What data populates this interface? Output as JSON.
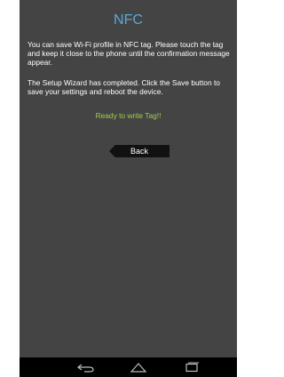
{
  "header": {
    "title": "NFC"
  },
  "content": {
    "instruction": "You can save Wi-Fi profile in NFC tag. Please touch the tag and keep it close to the phone until the confirmation message appear.",
    "completion": "The Setup Wizard has completed. Click the Save button to save your settings and reboot the device.",
    "status": "Ready to write Tag!!"
  },
  "actions": {
    "back_label": "Back"
  },
  "navbar": {
    "icons": [
      "back-icon",
      "home-icon",
      "recent-apps-icon"
    ]
  },
  "colors": {
    "background": "#444444",
    "title": "#5aa8dc",
    "status": "#9fd24a",
    "button": "#111111",
    "navbar": "#000000"
  }
}
